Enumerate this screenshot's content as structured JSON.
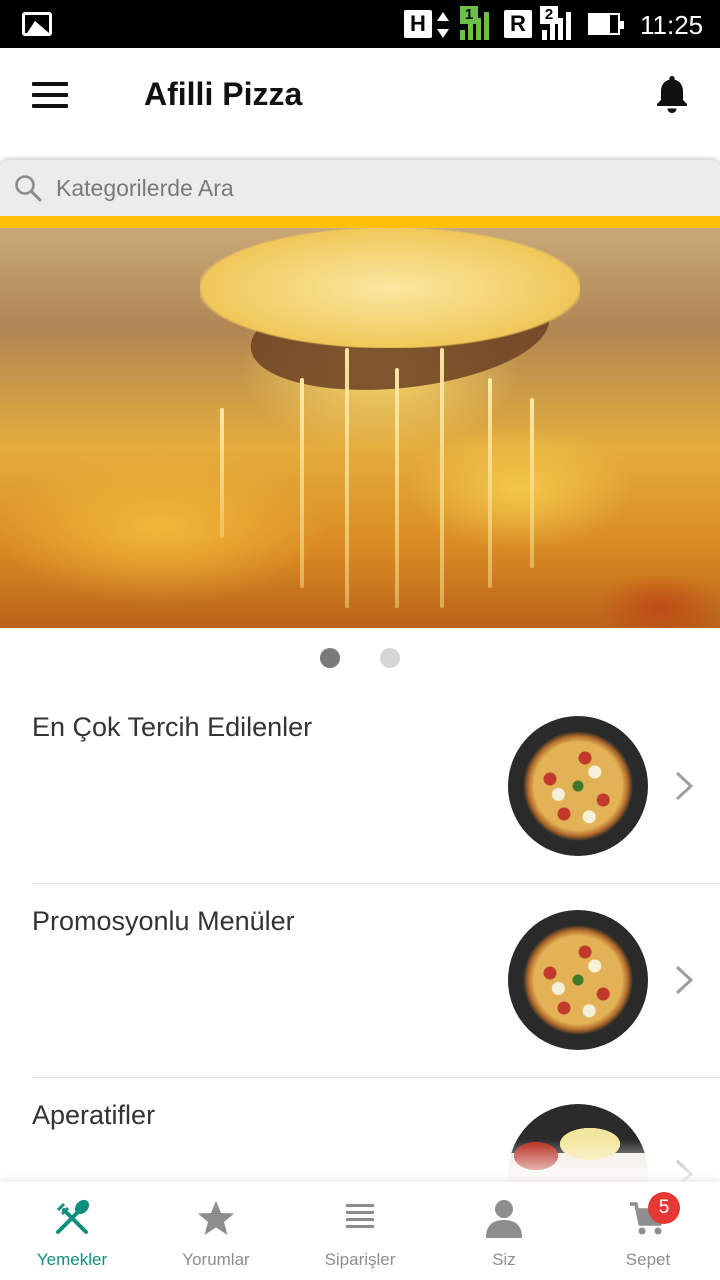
{
  "status_bar": {
    "network_h": "H",
    "sim1": "1",
    "network_r": "R",
    "sim2": "2",
    "time": "11:25",
    "icons": [
      "gallery-icon",
      "network-h-icon",
      "data-arrows-icon",
      "signal-bars-icon",
      "roaming-r-icon",
      "signal-bars-icon",
      "battery-icon"
    ],
    "sim1_color": "#6cc04a"
  },
  "app_bar": {
    "title": "Afilli Pizza",
    "menu_icon": "hamburger-menu-icon",
    "bell_icon": "bell-icon"
  },
  "search": {
    "placeholder": "Kategorilerde Ara",
    "value": ""
  },
  "carousel": {
    "image": "cheese-pizza-slice-photo",
    "active_index": 0,
    "pages": 2,
    "dot_active_color": "#7a7a7a",
    "dot_inactive_color": "#d6d6d6"
  },
  "categories": [
    {
      "label": "En Çok Tercih Edilenler",
      "image": "pizza-photo"
    },
    {
      "label": "Promosyonlu Menüler",
      "image": "pizza-photo"
    },
    {
      "label": "Aperatifler",
      "image": "appetizer-photo"
    }
  ],
  "bottom_nav": {
    "items": [
      {
        "label": "Yemekler",
        "icon": "fork-knife-icon",
        "active": true
      },
      {
        "label": "Yorumlar",
        "icon": "star-icon",
        "active": false
      },
      {
        "label": "Siparişler",
        "icon": "list-icon",
        "active": false
      },
      {
        "label": "Siz",
        "icon": "person-icon",
        "active": false
      },
      {
        "label": "Sepet",
        "icon": "cart-icon",
        "active": false
      }
    ],
    "cart_badge": "5",
    "active_color": "#0e8f7e",
    "inactive_color": "#8e8e8e",
    "badge_color": "#e53935"
  },
  "colors": {
    "accent": "#ffc107"
  }
}
